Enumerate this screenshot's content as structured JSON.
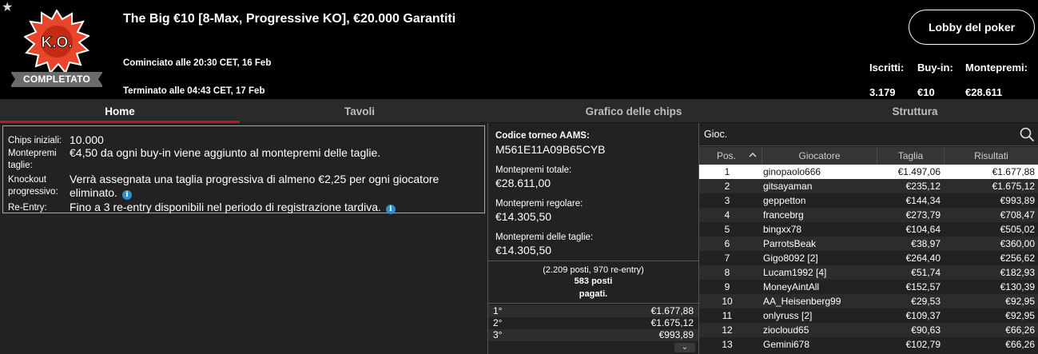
{
  "header": {
    "title": "The Big €10 [8-Max, Progressive KO], €20.000 Garantiti",
    "logo_text": "K.O.",
    "status": "COMPLETATO",
    "started": "Cominciato alle 20:30 CET, 16 Feb",
    "ended": "Terminato alle 04:43 CET, 17 Feb",
    "lobby_button": "Lobby del poker",
    "stats": {
      "entrants_label": "Iscritti:",
      "entrants_value": "3.179",
      "buyin_label": "Buy-in:",
      "buyin_value": "€10",
      "prize_label": "Montepremi:",
      "prize_value": "€28.611"
    }
  },
  "tabs": [
    {
      "label": "Home",
      "active": true
    },
    {
      "label": "Tavoli",
      "active": false
    },
    {
      "label": "Grafico delle chips",
      "active": false
    },
    {
      "label": "Struttura",
      "active": false
    }
  ],
  "info": [
    {
      "label": "Chips iniziali:",
      "value": "10.000",
      "info_icon": false
    },
    {
      "label": "Montepremi taglie:",
      "value": "€4,50 da ogni buy-in viene aggiunto al montepremi delle taglie.",
      "info_icon": false
    },
    {
      "label": "Knockout progressivo:",
      "value": "Verrà assegnata una taglia progressiva di almeno €2,25 per ogni giocatore eliminato.",
      "info_icon": true
    },
    {
      "label": "Re-Entry:",
      "value": "Fino a 3 re-entry disponibili nel periodo di registrazione tardiva.",
      "info_icon": true
    }
  ],
  "aams": {
    "code_label": "Codice torneo AAMS:",
    "code_value": "M561E11A09B65CYB",
    "total_label": "Montepremi totale:",
    "total_value": "€28.611,00",
    "regular_label": "Montepremi regolare:",
    "regular_value": "€14.305,50",
    "bounty_label": "Montepremi delle taglie:",
    "bounty_value": "€14.305,50"
  },
  "payouts": {
    "note_line1": "(2.209 posti, 970 re-entry)",
    "note_line2": "583 posti",
    "note_line3": "pagati.",
    "rows": [
      {
        "pos": "1°",
        "amount": "€1.677,88"
      },
      {
        "pos": "2°",
        "amount": "€1.675,12"
      },
      {
        "pos": "3°",
        "amount": "€993,89"
      }
    ]
  },
  "players": {
    "search_placeholder": "Gioc.",
    "columns": [
      "Pos.",
      "Giocatore",
      "Taglia",
      "Risultati"
    ],
    "selected_row": 0,
    "rows": [
      {
        "pos": "1",
        "name": "ginopaolo666",
        "bounty": "€1.497,06",
        "result": "€1.677,88"
      },
      {
        "pos": "2",
        "name": "gitsayaman",
        "bounty": "€235,12",
        "result": "€1.675,12"
      },
      {
        "pos": "3",
        "name": "geppetton",
        "bounty": "€144,34",
        "result": "€993,89"
      },
      {
        "pos": "4",
        "name": "francebrg",
        "bounty": "€273,79",
        "result": "€708,47"
      },
      {
        "pos": "5",
        "name": "bingxx78",
        "bounty": "€104,64",
        "result": "€505,02"
      },
      {
        "pos": "6",
        "name": "ParrotsBeak",
        "bounty": "€38,97",
        "result": "€360,00"
      },
      {
        "pos": "7",
        "name": "Gigo8092 [2]",
        "bounty": "€264,40",
        "result": "€256,62"
      },
      {
        "pos": "8",
        "name": "Lucam1992 [4]",
        "bounty": "€51,74",
        "result": "€182,93"
      },
      {
        "pos": "9",
        "name": "MoneyAintAll",
        "bounty": "€152,57",
        "result": "€130,39"
      },
      {
        "pos": "10",
        "name": "AA_Heisenberg99",
        "bounty": "€29,53",
        "result": "€92,95"
      },
      {
        "pos": "11",
        "name": "onlyruss [2]",
        "bounty": "€109,37",
        "result": "€92,95"
      },
      {
        "pos": "12",
        "name": "ziocloud65",
        "bounty": "€90,63",
        "result": "€66,26"
      },
      {
        "pos": "13",
        "name": "Gemini678",
        "bounty": "€102,79",
        "result": "€66,26"
      }
    ]
  },
  "colors": {
    "accent_red": "#c8102e",
    "info_blue": "#2e8fcf",
    "ko_orange": "#e8452a"
  }
}
